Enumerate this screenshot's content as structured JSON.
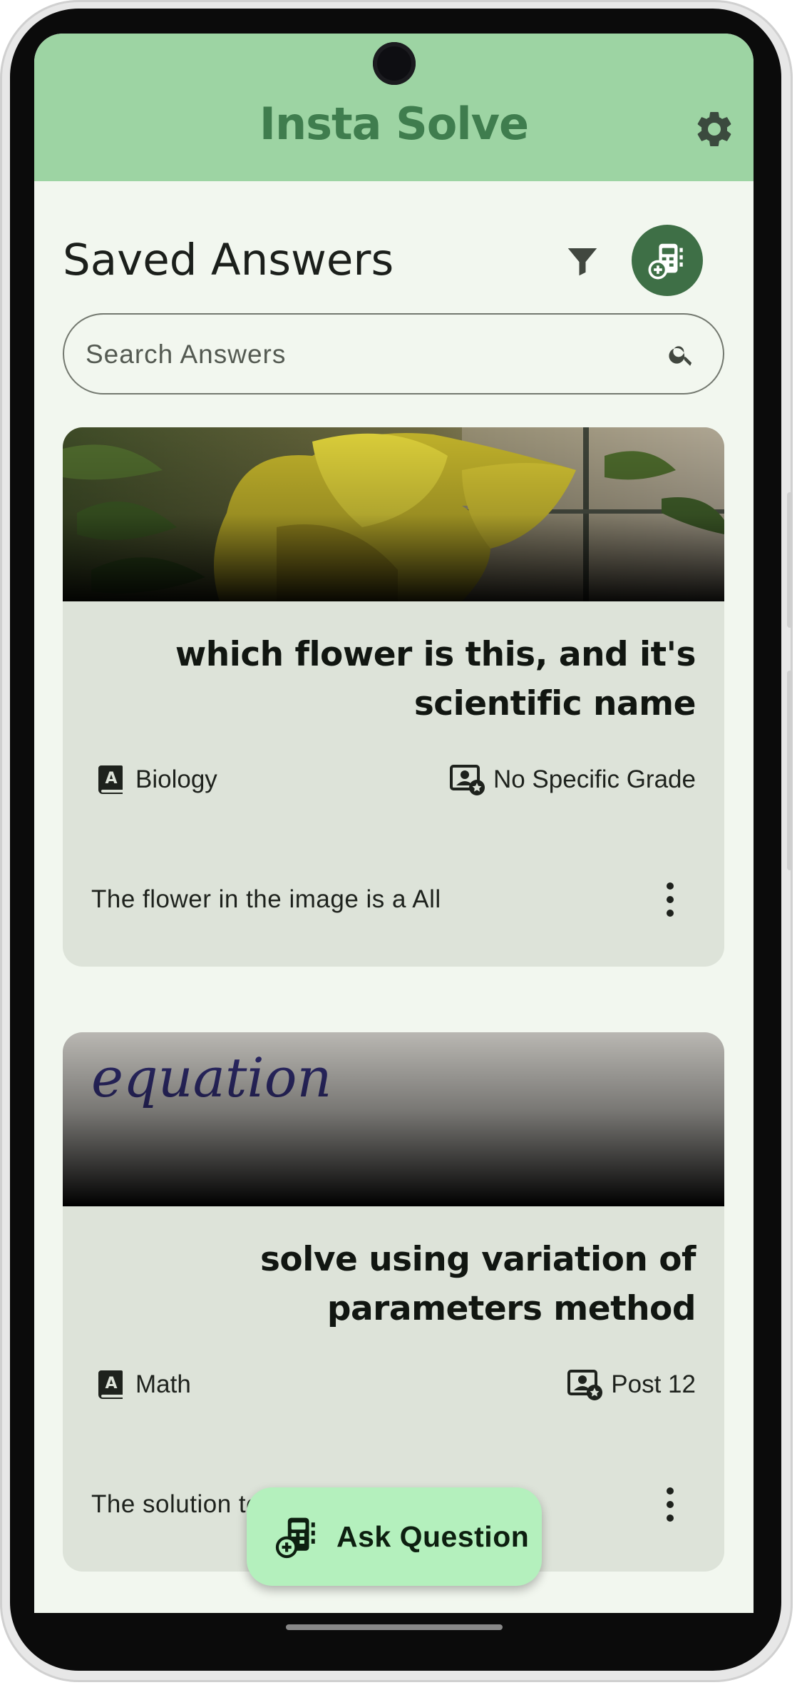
{
  "app": {
    "title": "Insta Solve"
  },
  "header": {
    "title": "Saved Answers"
  },
  "search": {
    "placeholder": "Search Answers",
    "value": ""
  },
  "cards": [
    {
      "question": "which flower is this, and it's scientific name",
      "subject": "Biology",
      "grade": "No Specific Grade",
      "answer_preview": "The flower in the image is a All"
    },
    {
      "question": "solve using variation of parameters method",
      "subject": "Math",
      "grade": "Post 12",
      "answer_preview": "The solution to"
    }
  ],
  "fab": {
    "label": "Ask Question"
  },
  "image_text": {
    "equation": "equation"
  },
  "icons": {
    "settings": "gear-icon",
    "filter": "filter-icon",
    "new_question": "calculator-add-icon",
    "search": "search-icon",
    "subject": "book-a-icon",
    "grade": "grade-badge-icon",
    "more": "more-vertical-icon"
  },
  "colors": {
    "appbar": "#9dd4a3",
    "title": "#3f7d4e",
    "accent": "#3e6f46",
    "fab": "#b4f0bd",
    "card": "#dde3d9",
    "background": "#f2f7ef"
  }
}
